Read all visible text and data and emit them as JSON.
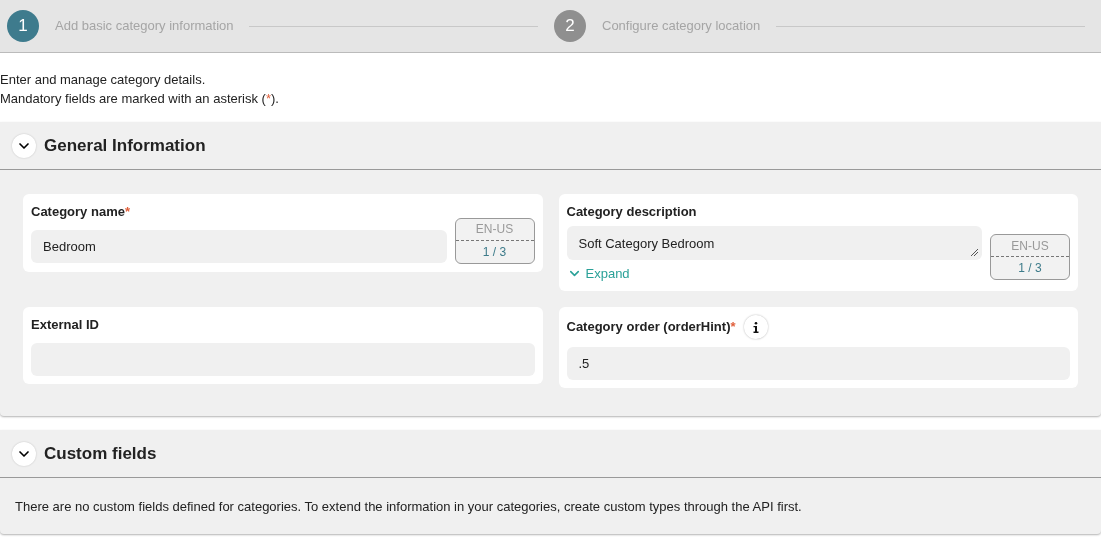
{
  "steps": [
    {
      "number": "1",
      "label": "Add basic category information",
      "selected": true
    },
    {
      "number": "2",
      "label": "Configure category location",
      "selected": false
    }
  ],
  "intro": {
    "line_1": "Enter and manage category details.",
    "line_2_before": "Mandatory fields are marked with an asterisk (",
    "line_2_mark": "*",
    "line_2_after": ")."
  },
  "sections": [
    {
      "title": "General Information",
      "expanded": true,
      "fields": [
        {
          "kind": "localized",
          "label": "Category name",
          "required": true,
          "value": "Bedroom",
          "locale": "EN-US",
          "count": "1 / 3"
        },
        {
          "kind": "textarea",
          "label": "Category description",
          "required": false,
          "value": "Soft Category Bedroom",
          "expand": "Expand",
          "locale": "EN-US",
          "count": "1 / 3"
        },
        {
          "kind": "text",
          "label": "External ID",
          "required": false,
          "info": false
        },
        {
          "kind": "text",
          "label": "Category order (orderHint)",
          "required": true,
          "info": true,
          "value": ".5"
        }
      ]
    },
    {
      "title": "Custom fields",
      "expanded": true,
      "message": "There are no custom fields defined for categories. To extend the information in your categories, create custom types through the API first."
    }
  ]
}
